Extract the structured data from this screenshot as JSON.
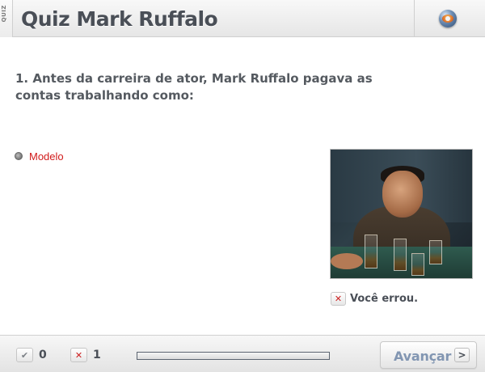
{
  "header": {
    "tab_label": "QUIZ",
    "title": "Quiz Mark Ruffalo",
    "logo_icon": "globo-logo-icon"
  },
  "question": {
    "text": "1. Antes da carreira de ator, Mark Ruffalo pagava as contas trabalhando como:"
  },
  "options": [
    {
      "label": "Modelo",
      "selected": true,
      "color": "#d11b1b"
    }
  ],
  "feedback": {
    "icon": "x-icon",
    "text": "Você errou."
  },
  "footer": {
    "correct_count": "0",
    "wrong_count": "1",
    "progress_fraction": 0,
    "next_label": "Avançar",
    "next_arrow": ">"
  },
  "colors": {
    "accent": "#8296b2",
    "error": "#cc1f1f",
    "title": "#4a4f57"
  }
}
